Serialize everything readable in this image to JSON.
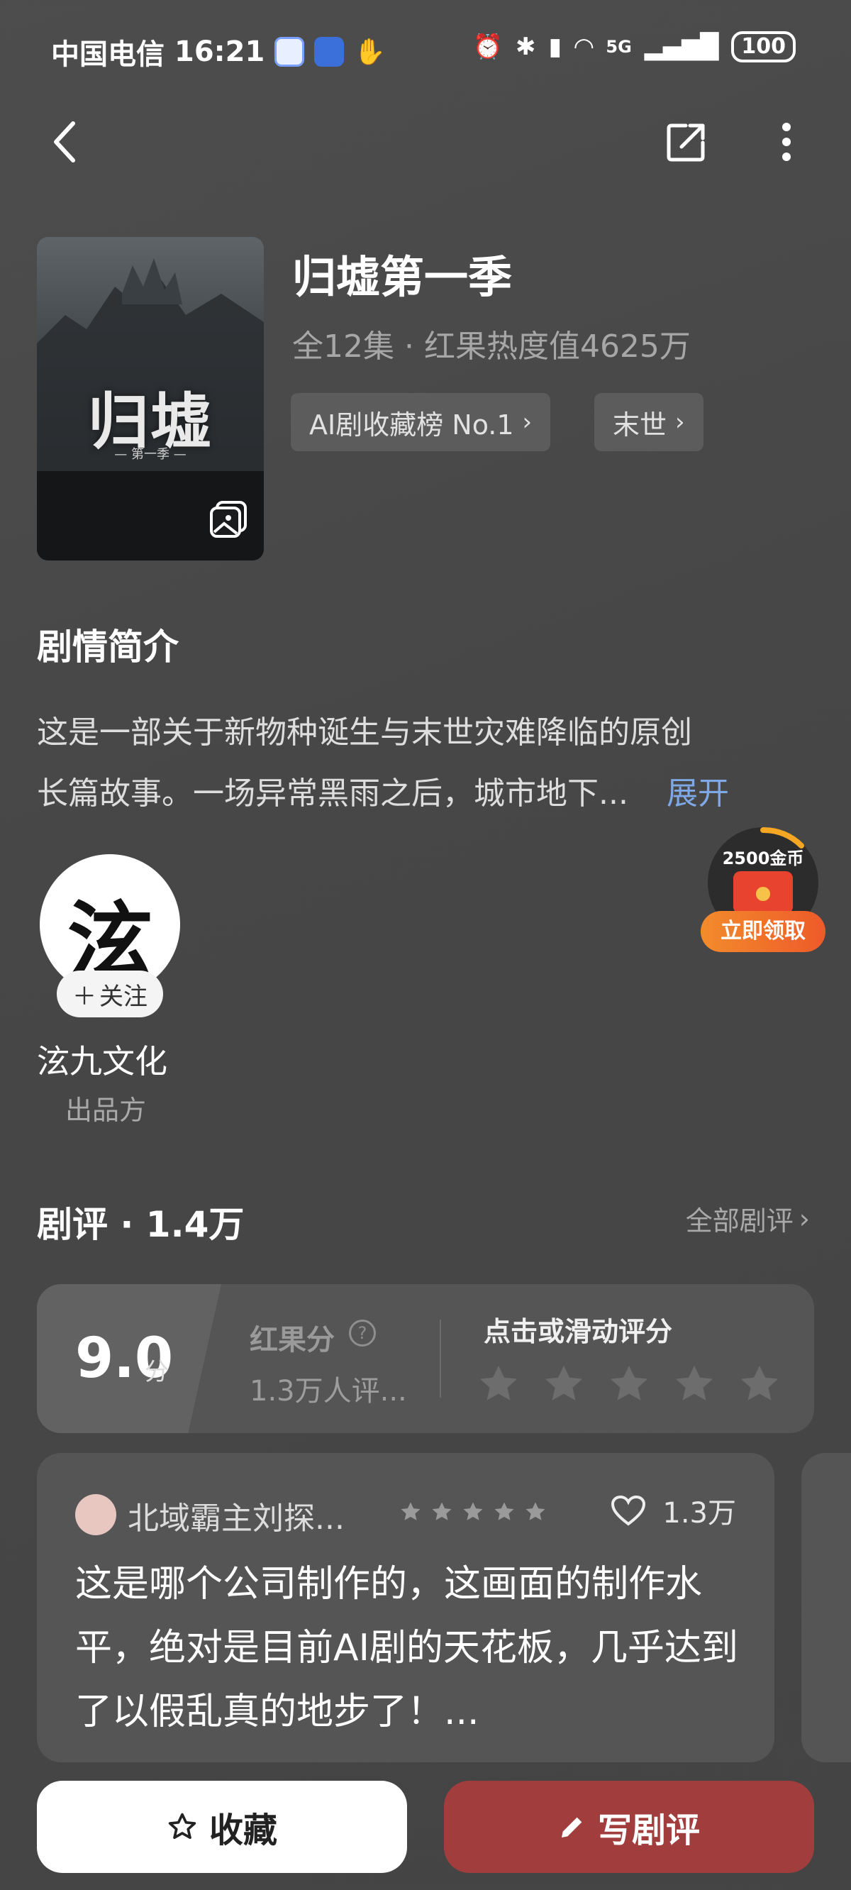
{
  "status_bar": {
    "carrier": "中国电信",
    "time": "16:21",
    "network": "5G",
    "battery": "100"
  },
  "drama": {
    "title": "归墟第一季",
    "meta": "全12集 · 红果热度值4625万",
    "poster_title": "归墟",
    "poster_subtitle": "— 第一季 —",
    "tags": [
      {
        "label": "AI剧收藏榜 No.1"
      },
      {
        "label": "末世"
      }
    ]
  },
  "synopsis": {
    "heading": "剧情简介",
    "text_line1": "这是一部关于新物种诞生与末世灾难降临的原创",
    "text_line2": "长篇故事。一场异常黑雨之后，城市地下...",
    "expand": "展开"
  },
  "producer": {
    "avatar_char": "泫",
    "follow": "关注",
    "name": "泫九文化",
    "role": "出品方"
  },
  "coin_widget": {
    "amount": "2500金币",
    "claim": "立即领取"
  },
  "reviews": {
    "heading": "剧评 · 1.4万",
    "all_link": "全部剧评",
    "score": "9.0",
    "score_unit": "分",
    "score_label": "红果分",
    "rated_count": "1.3万人评...",
    "rate_prompt": "点击或滑动评分",
    "star_count": 5,
    "items": [
      {
        "user": "北域霸主刘探...",
        "stars": 5,
        "likes": "1.3万",
        "text": "这是哪个公司制作的，这画面的制作水平，绝对是目前AI剧的天花板，几乎达到了以假乱真的地步了！..."
      }
    ]
  },
  "actions": {
    "favorite": "收藏",
    "write_review": "写剧评"
  },
  "colors": {
    "background": "#474747",
    "accent_red": "#a13d3d",
    "link_blue": "#7fa8e6",
    "coin_orange": "#f07a2a"
  }
}
